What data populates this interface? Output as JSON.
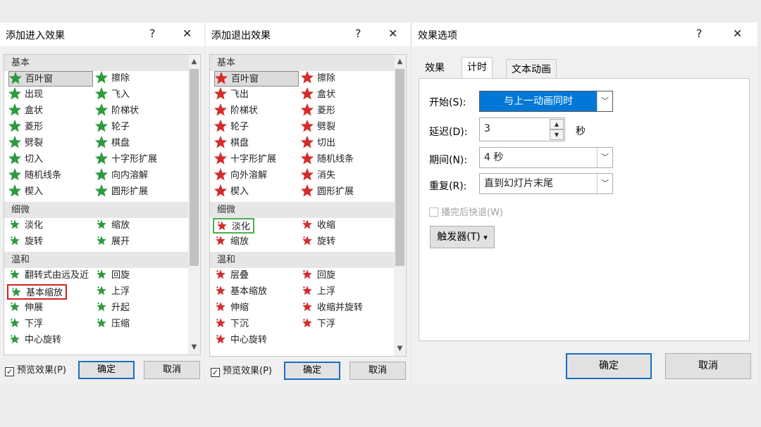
{
  "entrance": {
    "title": "添加进入效果",
    "help": "?",
    "close": "✕",
    "categories": [
      "基本",
      "细微",
      "温和"
    ],
    "basic": [
      "百叶窗",
      "擦除",
      "出现",
      "飞入",
      "盒状",
      "阶梯状",
      "菱形",
      "轮子",
      "劈裂",
      "棋盘",
      "切入",
      "十字形扩展",
      "随机线条",
      "向内溶解",
      "楔入",
      "圆形扩展"
    ],
    "subtle": [
      "淡化",
      "缩放",
      "旋转",
      "展开"
    ],
    "moderate": [
      "翻转式由远及近",
      "回旋",
      "基本缩放",
      "上浮",
      "伸展",
      "升起",
      "下浮",
      "压缩",
      "中心旋转"
    ],
    "preview_label": "预览效果(P)",
    "ok": "确定",
    "cancel": "取消"
  },
  "exit": {
    "title": "添加退出效果",
    "help": "?",
    "close": "✕",
    "categories": [
      "基本",
      "细微",
      "温和"
    ],
    "basic": [
      "百叶窗",
      "擦除",
      "飞出",
      "盒状",
      "阶梯状",
      "菱形",
      "轮子",
      "劈裂",
      "棋盘",
      "切出",
      "十字形扩展",
      "随机线条",
      "向外溶解",
      "消失",
      "楔入",
      "圆形扩展"
    ],
    "subtle": [
      "淡化",
      "收缩",
      "缩放",
      "旋转"
    ],
    "moderate": [
      "层叠",
      "回旋",
      "基本缩放",
      "上浮",
      "伸缩",
      "收缩并旋转",
      "下沉",
      "下浮",
      "中心旋转"
    ],
    "preview_label": "预览效果(P)",
    "ok": "确定",
    "cancel": "取消"
  },
  "options": {
    "title": "效果选项",
    "help": "?",
    "close": "✕",
    "tabs": [
      "效果",
      "计时",
      "文本动画"
    ],
    "start_label": "开始(S):",
    "start_value": "与上一动画同时",
    "delay_label": "延迟(D):",
    "delay_value": "3",
    "delay_unit": "秒",
    "duration_label": "期间(N):",
    "duration_value": "4 秒",
    "repeat_label": "重复(R):",
    "repeat_value": "直到幻灯片末尾",
    "rewind_label": "播完后快退(W)",
    "trigger_label": "触发器(T)",
    "ok": "确定",
    "cancel": "取消"
  },
  "colors": {
    "green_star": "#2e9a3e",
    "red_star": "#d62b2b",
    "green_box": "#4caf50",
    "red_box": "#d22020",
    "accent": "#0078d7"
  }
}
